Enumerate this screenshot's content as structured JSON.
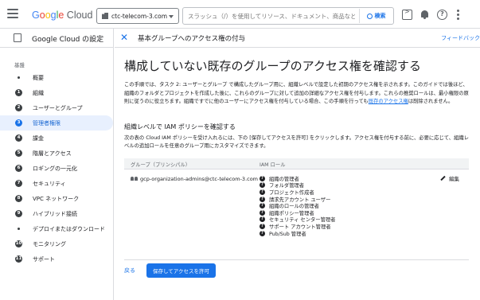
{
  "header": {
    "logo_google": [
      "G",
      "o",
      "o",
      "g",
      "l",
      "e"
    ],
    "logo_cloud": " Cloud",
    "project_name": "ctc-telecom-3.com",
    "search_placeholder": "スラッシュ（/）を使用してリソース、ドキュメント、商品など",
    "search_button": "検索"
  },
  "sidebar": {
    "title": "Google Cloud の設定",
    "section_label": "基盤",
    "items": [
      {
        "marker": "dot",
        "label": "概要"
      },
      {
        "marker": "1",
        "label": "組織"
      },
      {
        "marker": "2",
        "label": "ユーザーとグループ"
      },
      {
        "marker": "3",
        "label": "管理者権限",
        "active": true
      },
      {
        "marker": "4",
        "label": "課金"
      },
      {
        "marker": "5",
        "label": "階層とアクセス"
      },
      {
        "marker": "6",
        "label": "ロギングの一元化"
      },
      {
        "marker": "7",
        "label": "セキュリティ"
      },
      {
        "marker": "8",
        "label": "VPC ネットワーク"
      },
      {
        "marker": "9",
        "label": "ハイブリッド接続"
      },
      {
        "marker": "dot",
        "label": "デプロイまたはダウンロード"
      },
      {
        "marker": "10",
        "label": "モニタリング"
      },
      {
        "marker": "11",
        "label": "サポート"
      }
    ]
  },
  "panel": {
    "close_glyph": "✕",
    "title": "基本グループへのアクセス権の付与",
    "feedback": "フィードバック",
    "heading": "構成していない既存のグループのアクセス権を確認する",
    "intro_before_link": "この手順では、タスク 2: ユーザーとグループ で構成したグループ用に、組織レベルで設定した初期のアクセス権を示されます。このガイドでは後ほど、組織のフォルダとプロジェクトを作成した後に、これらのグループに対して追加の詳細なアクセス権を付与します。これらの推奨ロールは、最小権限の原則に従うのに役立ちます。組織ですでに他のユーザーにアクセス権を付与している場合、この手順を行っても",
    "intro_link": "既存のアクセス権",
    "intro_after_link": "は削除されません。",
    "section_heading": "組織レベルで IAM ポリシーを確認する",
    "section_desc": "次の表の Cloud IAM ポリシーを受け入れるには、下の [保存してアクセスを許可] をクリックします。アクセス権を付与する前に、必要に応じて、組織レベルの追加ロールを任意のグループ用にカスタマイズできます。",
    "table": {
      "col_group": "グループ（プリンシパル）",
      "col_roles": "IAM ロール",
      "member": "gcp-organization-admins@ctc-telecom-3.com",
      "edit_label": "編集",
      "role_icon_glyph": "?",
      "roles": [
        "組織の管理者",
        "フォルダ管理者",
        "プロジェクト作成者",
        "請求先アカウント ユーザー",
        "組織のロールの管理者",
        "組織ポリシー管理者",
        "セキュリティ センター管理者",
        "サポート アカウント管理者",
        "Pub/Sub 管理者"
      ]
    },
    "back_label": "戻る",
    "primary_label": "保存してアクセスを許可"
  }
}
